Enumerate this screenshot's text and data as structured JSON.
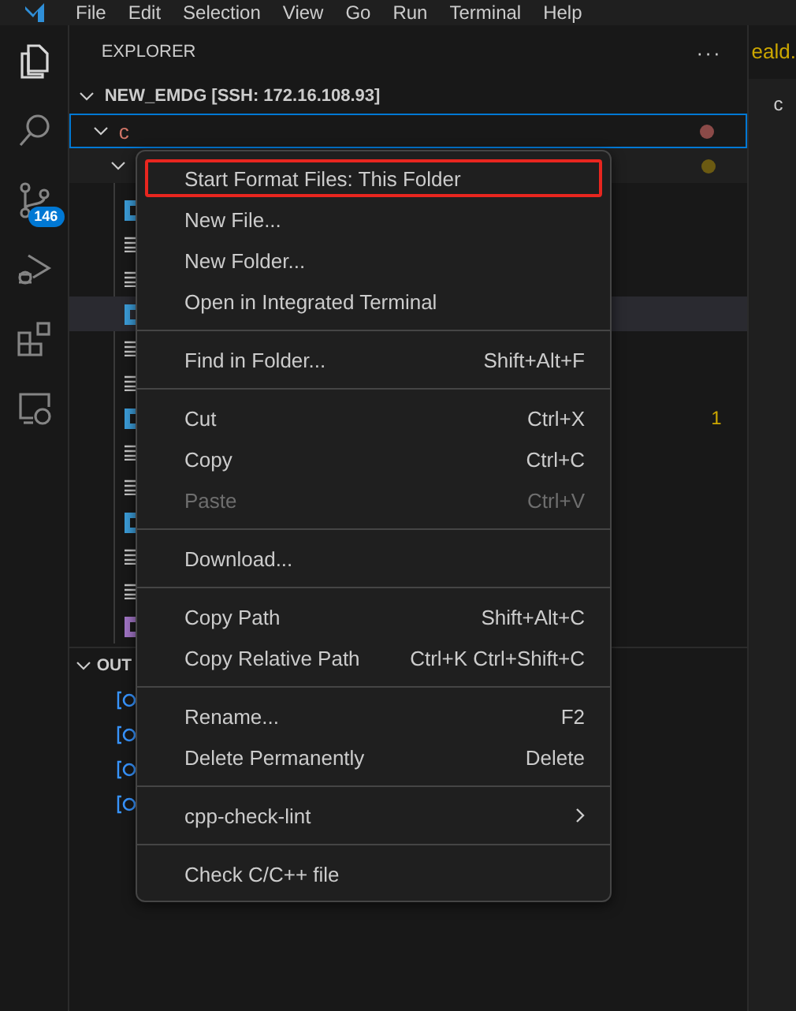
{
  "menubar": [
    "File",
    "Edit",
    "Selection",
    "View",
    "Go",
    "Run",
    "Terminal",
    "Help"
  ],
  "activity_bar": [
    {
      "kind": "files",
      "selected": true
    },
    {
      "kind": "search",
      "selected": false
    },
    {
      "kind": "source-control",
      "selected": false,
      "badge": "146"
    },
    {
      "kind": "run-debug",
      "selected": false
    },
    {
      "kind": "extensions",
      "selected": false
    },
    {
      "kind": "remote",
      "selected": false
    }
  ],
  "explorer": {
    "title": "EXPLORER",
    "more": "···",
    "root": {
      "label": "NEW_EMDG [SSH: 172.16.108.93]",
      "expanded": true
    },
    "folder": {
      "label": "c",
      "expanded": true,
      "selected": true,
      "color": "#8b4a48"
    },
    "subfolder": {
      "expanded": true,
      "color": "#6b5a12"
    },
    "files": [
      {
        "kind": "c",
        "color": "#3b9bd6",
        "hovered": false
      },
      {
        "kind": "text",
        "hovered": false
      },
      {
        "kind": "text",
        "hovered": false
      },
      {
        "kind": "c",
        "color": "#3b9bd6",
        "hovered": true
      },
      {
        "kind": "text",
        "hovered": false
      },
      {
        "kind": "text",
        "hovered": false
      },
      {
        "kind": "c",
        "color": "#3b9bd6",
        "hovered": false,
        "badge": "1"
      },
      {
        "kind": "text",
        "hovered": false
      },
      {
        "kind": "text",
        "hovered": false
      },
      {
        "kind": "c",
        "color": "#3b9bd6",
        "hovered": false
      },
      {
        "kind": "text",
        "hovered": false
      },
      {
        "kind": "text",
        "hovered": false
      },
      {
        "kind": "c",
        "color": "#a074c4",
        "hovered": false
      }
    ]
  },
  "outline": {
    "title": "OUT",
    "expanded": true,
    "items": [
      {
        "kind": "module"
      },
      {
        "kind": "module"
      },
      {
        "kind": "module"
      },
      {
        "kind": "module"
      }
    ]
  },
  "editor": {
    "tab": "eald.",
    "line": "c"
  },
  "context_menu": [
    {
      "kind": "item",
      "label": "Start Format Files: This Folder",
      "outlined": true,
      "disabled": false
    },
    {
      "kind": "item",
      "label": "New File...",
      "outlined": false,
      "disabled": false
    },
    {
      "kind": "item",
      "label": "New Folder...",
      "outlined": false,
      "disabled": false
    },
    {
      "kind": "item",
      "label": "Open in Integrated Terminal",
      "outlined": false,
      "disabled": false
    },
    {
      "kind": "separator"
    },
    {
      "kind": "item",
      "label": "Find in Folder...",
      "shortcut": "Shift+Alt+F",
      "outlined": false,
      "disabled": false
    },
    {
      "kind": "separator"
    },
    {
      "kind": "item",
      "label": "Cut",
      "shortcut": "Ctrl+X",
      "outlined": false,
      "disabled": false
    },
    {
      "kind": "item",
      "label": "Copy",
      "shortcut": "Ctrl+C",
      "outlined": false,
      "disabled": false
    },
    {
      "kind": "item",
      "label": "Paste",
      "shortcut": "Ctrl+V",
      "outlined": false,
      "disabled": true
    },
    {
      "kind": "separator"
    },
    {
      "kind": "item",
      "label": "Download...",
      "outlined": false,
      "disabled": false
    },
    {
      "kind": "separator"
    },
    {
      "kind": "item",
      "label": "Copy Path",
      "shortcut": "Shift+Alt+C",
      "outlined": false,
      "disabled": false
    },
    {
      "kind": "item",
      "label": "Copy Relative Path",
      "shortcut": "Ctrl+K Ctrl+Shift+C",
      "outlined": false,
      "disabled": false
    },
    {
      "kind": "separator"
    },
    {
      "kind": "item",
      "label": "Rename...",
      "shortcut": "F2",
      "outlined": false,
      "disabled": false
    },
    {
      "kind": "item",
      "label": "Delete Permanently",
      "shortcut": "Delete",
      "outlined": false,
      "disabled": false
    },
    {
      "kind": "separator"
    },
    {
      "kind": "submenu",
      "label": "cpp-check-lint",
      "outlined": false,
      "disabled": false
    },
    {
      "kind": "separator"
    },
    {
      "kind": "item",
      "label": "Check C/C++ file",
      "outlined": false,
      "disabled": false
    }
  ]
}
